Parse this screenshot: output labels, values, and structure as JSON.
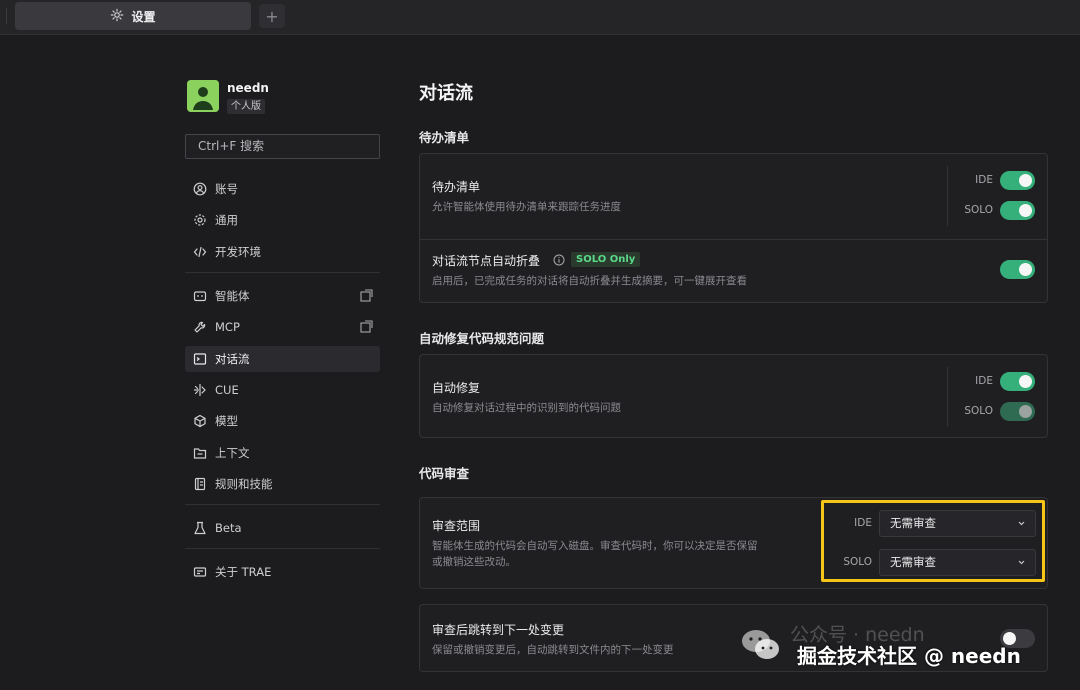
{
  "tabs": {
    "settings_label": "设置",
    "add_label": "+"
  },
  "user": {
    "name": "needn",
    "plan": "个人版"
  },
  "search": {
    "placeholder": "Ctrl+F 搜索"
  },
  "sidebar": {
    "items": [
      {
        "label": "账号",
        "icon": "account-icon"
      },
      {
        "label": "通用",
        "icon": "gear-icon"
      },
      {
        "label": "开发环境",
        "icon": "code-icon"
      },
      {
        "label": "智能体",
        "icon": "agent-icon",
        "external": true
      },
      {
        "label": "MCP",
        "icon": "mcp-icon",
        "external": true
      },
      {
        "label": "对话流",
        "icon": "terminal-icon",
        "active": true
      },
      {
        "label": "CUE",
        "icon": "cue-icon"
      },
      {
        "label": "模型",
        "icon": "model-icon"
      },
      {
        "label": "上下文",
        "icon": "context-icon"
      },
      {
        "label": "规则和技能",
        "icon": "rules-icon"
      },
      {
        "label": "Beta",
        "icon": "beta-icon"
      },
      {
        "label": "关于 TRAE",
        "icon": "about-icon"
      }
    ]
  },
  "main": {
    "title": "对话流",
    "todo": {
      "section": "待办清单",
      "item1": {
        "title": "待办清单",
        "desc": "允许智能体使用待办清单来跟踪任务进度",
        "ide_label": "IDE",
        "solo_label": "SOLO",
        "ide_on": true,
        "solo_on": true
      },
      "item2": {
        "title": "对话流节点自动折叠",
        "badge": "SOLO Only",
        "desc": "启用后，已完成任务的对话将自动折叠并生成摘要，可一键展开查看",
        "on": true
      }
    },
    "autofix": {
      "section": "自动修复代码规范问题",
      "item": {
        "title": "自动修复",
        "desc": "自动修复对话过程中的识别到的代码问题",
        "ide_label": "IDE",
        "solo_label": "SOLO",
        "ide_on": true,
        "solo_on": true
      }
    },
    "review": {
      "section": "代码审查",
      "scope": {
        "title": "审查范围",
        "desc_line1": "智能体生成的代码会自动写入磁盘。审查代码时，你可以决定是否保留",
        "desc_line2": "或撤销这些改动。",
        "ide_label": "IDE",
        "solo_label": "SOLO",
        "ide_value": "无需审查",
        "solo_value": "无需审查"
      },
      "jump": {
        "title": "审查后跳转到下一处变更",
        "desc": "保留或撤销变更后，自动跳转到文件内的下一处变更",
        "on": false
      }
    }
  },
  "colors": {
    "accent_green": "#35b07a",
    "highlight": "#f5c518",
    "background": "#1c1c1e"
  },
  "watermark": {
    "faded_text": "公众号 · needn",
    "main_text": "掘金技术社区 @ needn"
  }
}
